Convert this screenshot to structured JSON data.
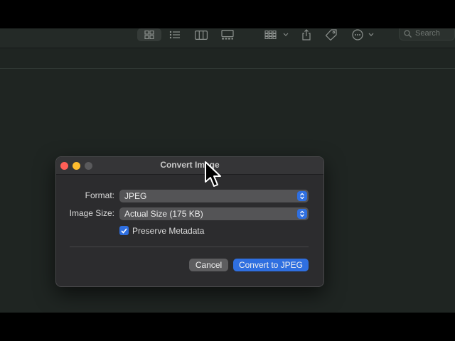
{
  "toolbar": {
    "buttons": [
      {
        "icon": "icon-grid-view-icon",
        "active": true
      },
      {
        "icon": "list-view-icon"
      },
      {
        "icon": "column-view-icon"
      },
      {
        "icon": "gallery-view-icon"
      },
      {
        "icon": "group-by-icon"
      },
      {
        "icon": "share-icon"
      },
      {
        "icon": "tag-icon"
      },
      {
        "icon": "more-actions-icon"
      }
    ],
    "search_placeholder": "Search"
  },
  "dialog": {
    "title": "Convert Image",
    "format_label": "Format:",
    "format_value": "JPEG",
    "size_label": "Image Size:",
    "size_value": "Actual Size (175 KB)",
    "preserve_metadata_label": "Preserve Metadata",
    "preserve_metadata_checked": true,
    "cancel_label": "Cancel",
    "convert_label": "Convert to JPEG"
  },
  "colors": {
    "accent": "#2f6fe0",
    "close": "#ff5f57",
    "minimize": "#febc2e"
  }
}
